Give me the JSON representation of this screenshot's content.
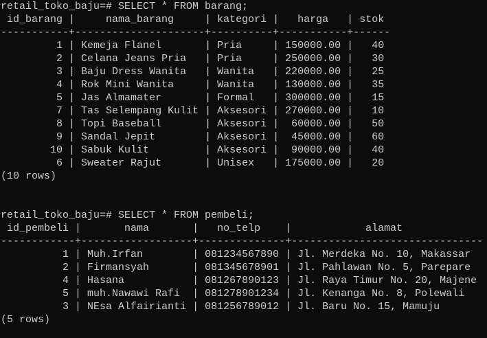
{
  "colors": {
    "background": "#0c0c0c",
    "text": "#cccccc"
  },
  "queries": [
    {
      "prompt": "retail_toko_baju=# SELECT * FROM barang;",
      "columns": [
        {
          "name": "id_barang",
          "align": "right"
        },
        {
          "name": "nama_barang",
          "align": "left"
        },
        {
          "name": "kategori",
          "align": "left"
        },
        {
          "name": "harga",
          "align": "right"
        },
        {
          "name": "stok",
          "align": "right"
        }
      ],
      "rows": [
        [
          "1",
          "Kemeja Flanel",
          "Pria",
          "150000.00",
          "40"
        ],
        [
          "2",
          "Celana Jeans Pria",
          "Pria",
          "250000.00",
          "30"
        ],
        [
          "3",
          "Baju Dress Wanita",
          "Wanita",
          "220000.00",
          "25"
        ],
        [
          "4",
          "Rok Mini Wanita",
          "Wanita",
          "130000.00",
          "35"
        ],
        [
          "5",
          "Jas Almamater",
          "Formal",
          "300000.00",
          "15"
        ],
        [
          "7",
          "Tas Selempang Kulit",
          "Aksesori",
          "270000.00",
          "10"
        ],
        [
          "8",
          "Topi Baseball",
          "Aksesori",
          "60000.00",
          "50"
        ],
        [
          "9",
          "Sandal Jepit",
          "Aksesori",
          "45000.00",
          "60"
        ],
        [
          "10",
          "Sabuk Kulit",
          "Aksesori",
          "90000.00",
          "40"
        ],
        [
          "6",
          "Sweater Rajut",
          "Unisex",
          "175000.00",
          "20"
        ]
      ],
      "footer": "(10 rows)"
    },
    {
      "prompt": "retail_toko_baju=# SELECT * FROM pembeli;",
      "columns": [
        {
          "name": "id_pembeli",
          "align": "right"
        },
        {
          "name": "nama",
          "align": "left"
        },
        {
          "name": "no_telp",
          "align": "left"
        },
        {
          "name": "alamat",
          "align": "left"
        }
      ],
      "rows": [
        [
          "1",
          "Muh.Irfan",
          "081234567890",
          "Jl. Merdeka No. 10, Makassar"
        ],
        [
          "2",
          "Firmansyah",
          "081345678901",
          "Jl. Pahlawan No. 5, Parepare"
        ],
        [
          "4",
          "Hasana",
          "081267890123",
          "Jl. Raya Timur No. 20, Majene"
        ],
        [
          "5",
          "muh.Nawawi Rafi",
          "081278901234",
          "Jl. Kenanga No. 8, Polewali"
        ],
        [
          "3",
          "NEsa Alfairianti",
          "081256789012",
          "Jl. Baru No. 15, Mamuju"
        ]
      ],
      "footer": "(5 rows)"
    }
  ]
}
